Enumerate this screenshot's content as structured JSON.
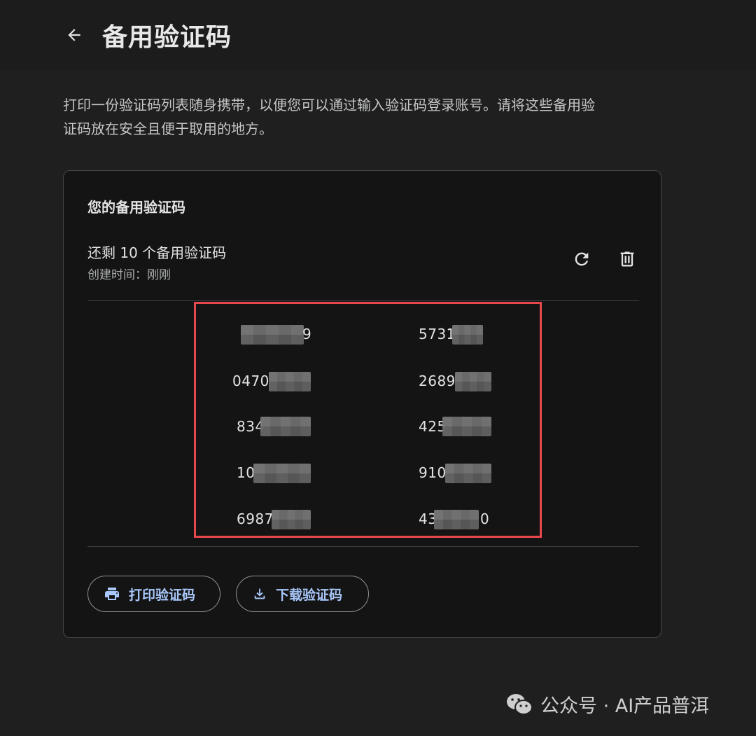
{
  "header": {
    "title": "备用验证码",
    "back_icon": "arrow-left-icon"
  },
  "description": "打印一份验证码列表随身携带，以便您可以通过输入验证码登录账号。请将这些备用验证码放在安全且便于取用的地方。",
  "card": {
    "title": "您的备用验证码",
    "remaining": "还剩 10 个备用验证码",
    "created": "创建时间：刚刚",
    "refresh_icon": "refresh-icon",
    "delete_icon": "trash-icon",
    "codes": {
      "left": [
        "9",
        "0470",
        "834",
        "10",
        "6987"
      ],
      "right": [
        "5731",
        "2689",
        "425",
        "910",
        "43"
      ],
      "right_suffix_5": "0"
    },
    "highlight_color": "#e8474d"
  },
  "buttons": {
    "print_label": "打印验证码",
    "print_icon": "printer-icon",
    "download_label": "下载验证码",
    "download_icon": "download-icon",
    "accent_color": "#a8c7fa"
  },
  "watermark": {
    "text": "公众号 · AI产品普洱",
    "icon": "wechat-icon"
  }
}
